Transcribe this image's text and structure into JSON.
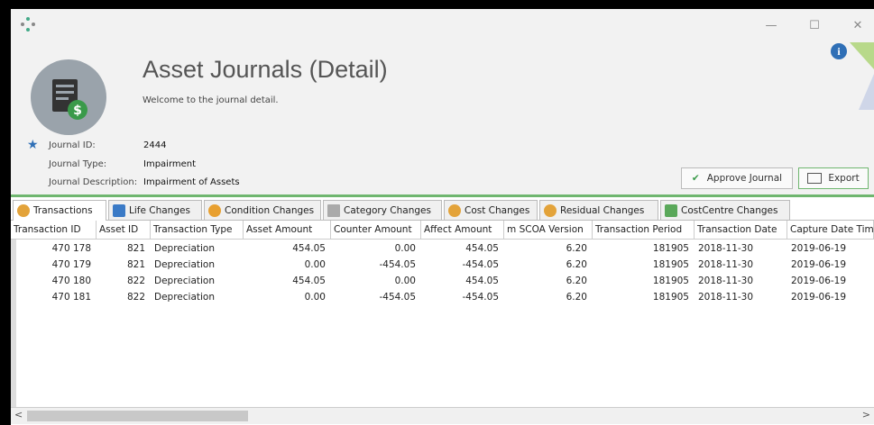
{
  "window": {
    "controls": [
      "—",
      "☐",
      "✕"
    ]
  },
  "header": {
    "title": "Asset Journals (Detail)",
    "subtitle": "Welcome to the journal detail.",
    "fields": [
      {
        "label": "Journal ID:",
        "value": "2444"
      },
      {
        "label": "Journal Type:",
        "value": "Impairment"
      },
      {
        "label": "Journal Description:",
        "value": "Impairment of Assets"
      }
    ],
    "buttons": {
      "approve": "Approve Journal",
      "export": "Export"
    },
    "info": "i"
  },
  "tabs": [
    {
      "label": "Transactions",
      "active": true
    },
    {
      "label": "Life Changes"
    },
    {
      "label": "Condition Changes"
    },
    {
      "label": "Category Changes"
    },
    {
      "label": "Cost Changes"
    },
    {
      "label": "Residual Changes"
    },
    {
      "label": "CostCentre Changes"
    }
  ],
  "grid": {
    "columns": [
      "Transaction ID",
      "Asset ID",
      "Transaction Type",
      "Asset Amount",
      "Counter Amount",
      "Affect Amount",
      "m SCOA Version",
      "Transaction Period",
      "Transaction Date",
      "Capture Date Time"
    ],
    "rows": [
      [
        "470 178",
        "821",
        "Depreciation",
        "454.05",
        "0.00",
        "454.05",
        "6.20",
        "181905",
        "2018-11-30",
        "2019-06-19"
      ],
      [
        "470 179",
        "821",
        "Depreciation",
        "0.00",
        "-454.05",
        "-454.05",
        "6.20",
        "181905",
        "2018-11-30",
        "2019-06-19"
      ],
      [
        "470 180",
        "822",
        "Depreciation",
        "454.05",
        "0.00",
        "454.05",
        "6.20",
        "181905",
        "2018-11-30",
        "2019-06-19"
      ],
      [
        "470 181",
        "822",
        "Depreciation",
        "0.00",
        "-454.05",
        "-454.05",
        "6.20",
        "181905",
        "2018-11-30",
        "2019-06-19"
      ]
    ]
  },
  "scroll": {
    "left": "<",
    "right": ">"
  },
  "colors": {
    "accent_green": "#6fb66f",
    "accent_blue": "#2f6fb6"
  }
}
